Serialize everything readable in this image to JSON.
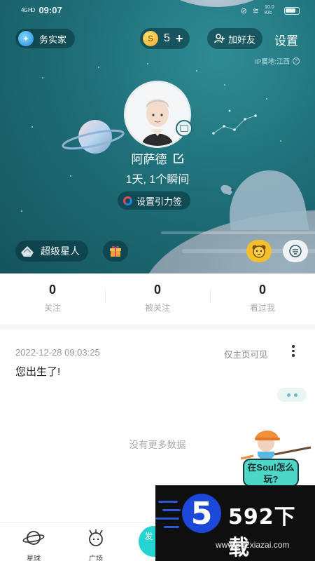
{
  "status_bar": {
    "signal": "4G HD",
    "time": "09:07",
    "net_speed": "10.0 K/s"
  },
  "header": {
    "worker_bee_label": "务实家",
    "coins": {
      "value": "5",
      "plus": "+"
    },
    "add_friend_label": "加好友",
    "settings_label": "设置",
    "ip_location": "IP属地:江西",
    "ip_help": "?"
  },
  "profile": {
    "name": "阿萨德",
    "days_stats": "1天, 1个瞬间",
    "gravity_tag_label": "设置引力签",
    "superstar_label": "超级星人"
  },
  "stats": [
    {
      "value": "0",
      "label": "关注"
    },
    {
      "value": "0",
      "label": "被关注"
    },
    {
      "value": "0",
      "label": "看过我"
    }
  ],
  "post": {
    "timestamp": "2022-12-28 09:03:25",
    "visibility": "仅主页可见",
    "text": "您出生了!"
  },
  "feed": {
    "no_more": "没有更多数据"
  },
  "guide": {
    "bubble_text": "在Soul怎么玩?"
  },
  "nav": {
    "planet_label": "星球",
    "square_label": "广场",
    "post_label": "发 瞬"
  },
  "watermark": {
    "logo_text": "5",
    "brand": "592下载",
    "url": "www.592xiazai.com"
  },
  "colors": {
    "hero": "#1e6e78",
    "accent": "#25d4d0",
    "coin": "#f0a81e"
  }
}
